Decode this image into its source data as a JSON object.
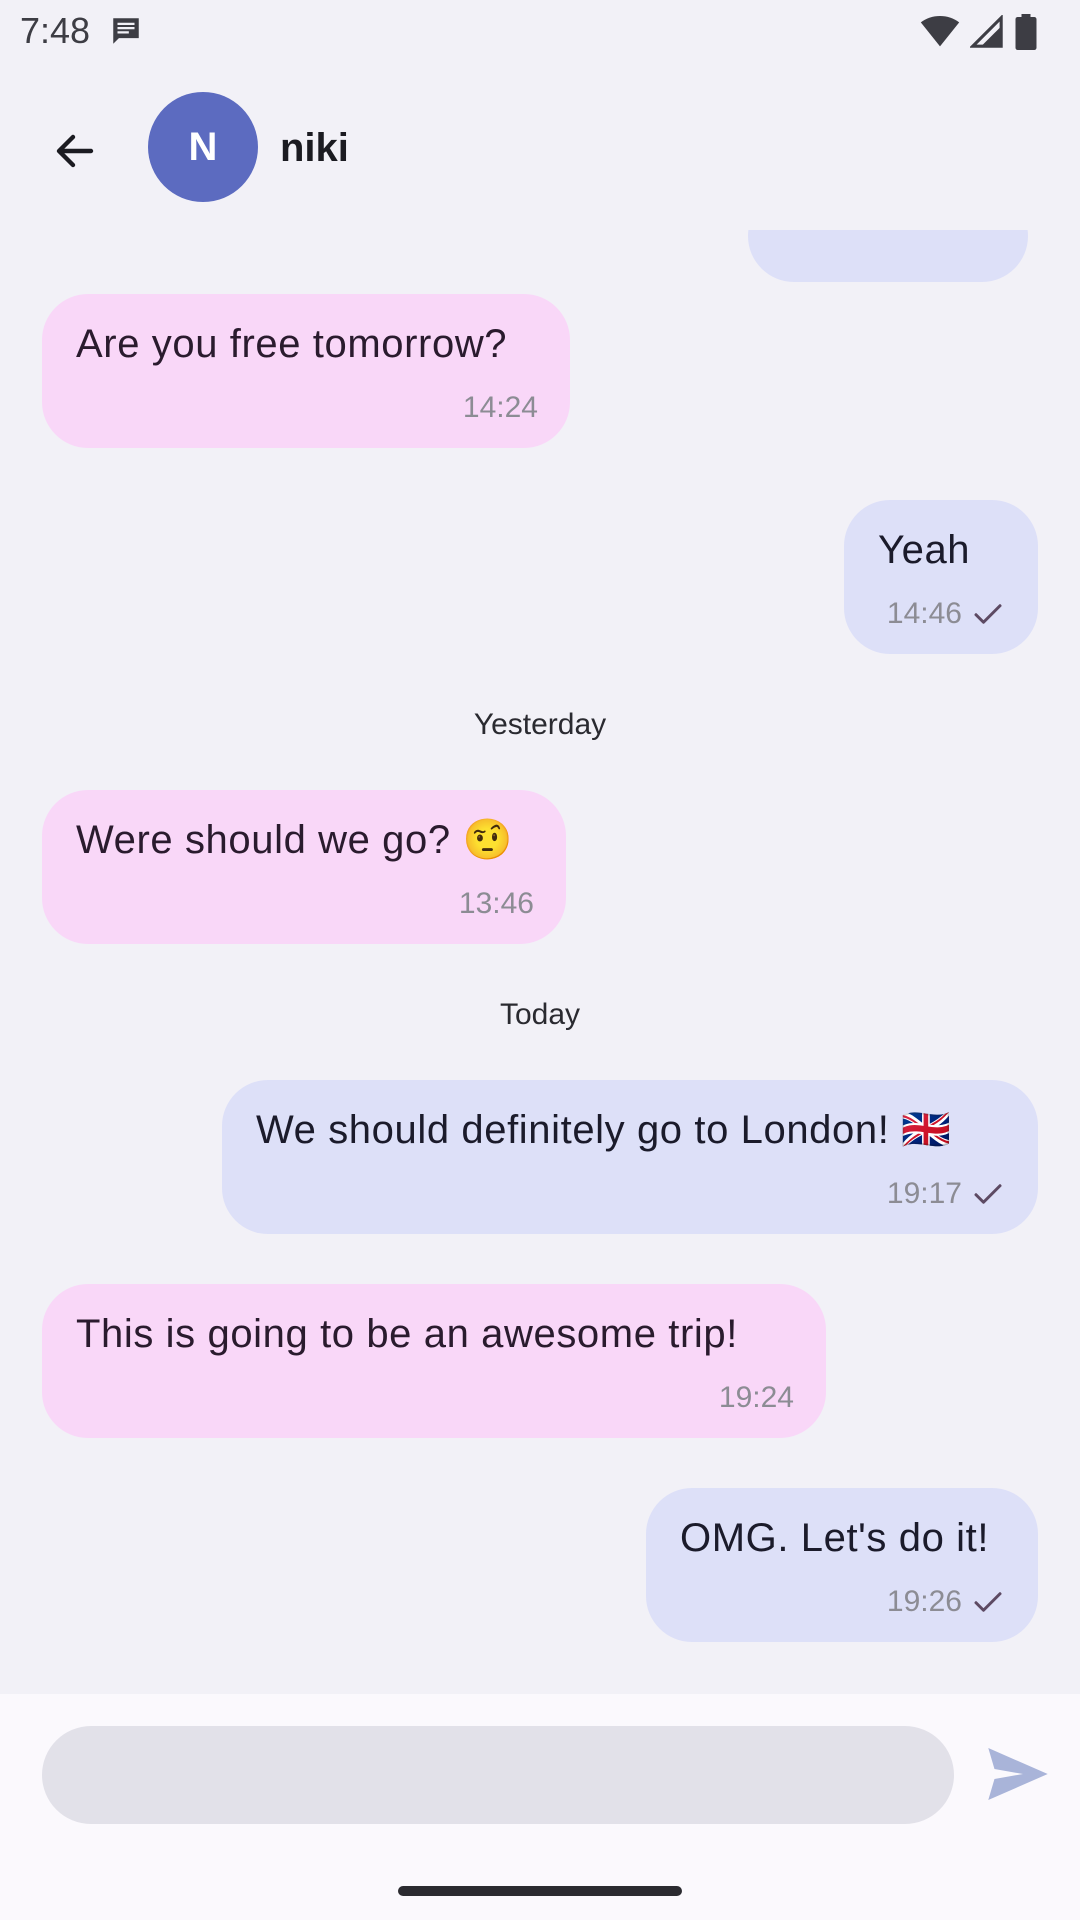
{
  "status_bar": {
    "time": "7:48",
    "notification_icon": "message-icon",
    "icons": [
      "wifi-icon",
      "signal-icon",
      "battery-icon"
    ]
  },
  "header": {
    "back_icon": "arrow-back-icon",
    "avatar_initial": "N",
    "contact_name": "niki",
    "avatar_color": "#5c6bc0"
  },
  "messages": [
    {
      "direction": "in",
      "text": "Are you free tomorrow?",
      "time": "14:24"
    },
    {
      "direction": "out",
      "text": "Yeah",
      "time": "14:46",
      "status": "sent"
    },
    {
      "separator": "Yesterday"
    },
    {
      "direction": "in",
      "text": "Were should we go? 🤨",
      "time": "13:46"
    },
    {
      "separator": "Today"
    },
    {
      "direction": "out",
      "text": "We should definitely go to London! 🇬🇧",
      "time": "19:17",
      "status": "sent"
    },
    {
      "direction": "in",
      "text": "This is going to be an awesome trip!",
      "time": "19:24"
    },
    {
      "direction": "out",
      "text": "OMG. Let's do it!",
      "time": "19:26",
      "status": "sent"
    }
  ],
  "composer": {
    "input_value": "",
    "placeholder": "",
    "send_icon": "send-icon"
  },
  "colors": {
    "background": "#f2f1f7",
    "incoming_bubble": "#f9d7f8",
    "outgoing_bubble": "#dde0f8",
    "send_icon": "#a9b4d9"
  }
}
